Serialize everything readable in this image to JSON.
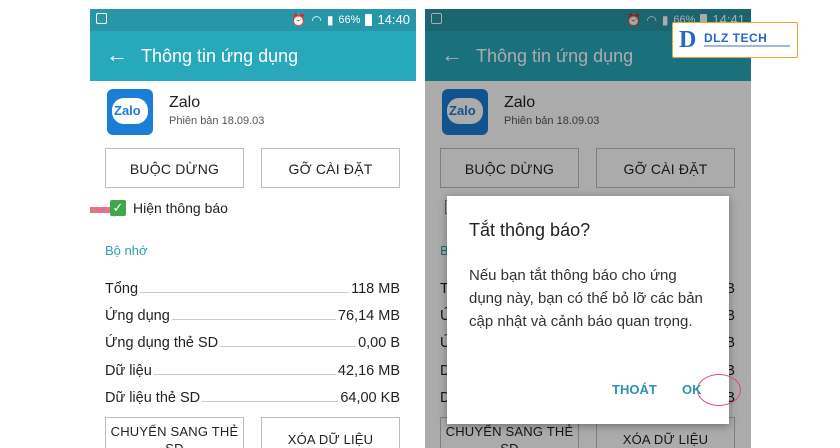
{
  "screen_left": {
    "status": {
      "battery": "66%",
      "time": "14:40"
    },
    "appbar": {
      "back_icon": "arrow-left-icon",
      "title": "Thông tin ứng dụng"
    },
    "app": {
      "name": "Zalo",
      "version": "Phiên bản 18.09.03",
      "logo_text": "Zalo"
    },
    "buttons": {
      "force_stop": "BUỘC DỪNG",
      "uninstall": "GỠ CÀI ĐẶT"
    },
    "notifications": {
      "label": "Hiện thông báo",
      "checked": true
    },
    "storage": {
      "title": "Bộ nhớ",
      "rows": [
        {
          "label": "Tổng",
          "value": "118 MB"
        },
        {
          "label": "Ứng dụng",
          "value": "76,14 MB"
        },
        {
          "label": "Ứng dụng thẻ SD",
          "value": "0,00 B"
        },
        {
          "label": "Dữ liệu",
          "value": "42,16 MB"
        },
        {
          "label": "Dữ liệu thẻ SD",
          "value": "64,00 KB"
        }
      ],
      "move_button": "CHUYỂN SANG THẺ SD",
      "clear_button": "XÓA DỮ LIỆU"
    }
  },
  "screen_right": {
    "status": {
      "battery": "66%",
      "time": "14:41"
    },
    "appbar": {
      "back_icon": "arrow-left-icon",
      "title": "Thông tin ứng dụng"
    },
    "app": {
      "name": "Zalo",
      "version": "Phiên bản 18.09.03",
      "logo_text": "Zalo"
    },
    "buttons": {
      "force_stop": "BUỘC DỪNG",
      "uninstall": "GỠ CÀI ĐẶT"
    },
    "storage_title_partial": "B",
    "storage_rows_partial": [
      "T",
      "Ứ",
      "Ứ",
      "D",
      "D"
    ],
    "storage_values_partial": [
      "B",
      "B",
      "B",
      "B",
      "B"
    ],
    "move_button": "CHUYỂN SANG THẺ SD",
    "clear_button": "XÓA DỮ LIỆU",
    "dialog": {
      "title": "Tắt thông báo?",
      "body": "Nếu bạn tắt thông báo cho ứng dụng này, bạn có thể bỏ lỡ các bản cập nhật và cảnh báo quan trọng.",
      "cancel": "THOÁT",
      "ok": "OK"
    }
  },
  "watermark": {
    "logo": "D",
    "text": "DLZ TECH"
  },
  "colors": {
    "status_bar": "#2797a8",
    "app_bar": "#28a9bb",
    "accent": "#2aa0b3",
    "check": "#3ea84a",
    "highlight": "#de4a6a"
  }
}
